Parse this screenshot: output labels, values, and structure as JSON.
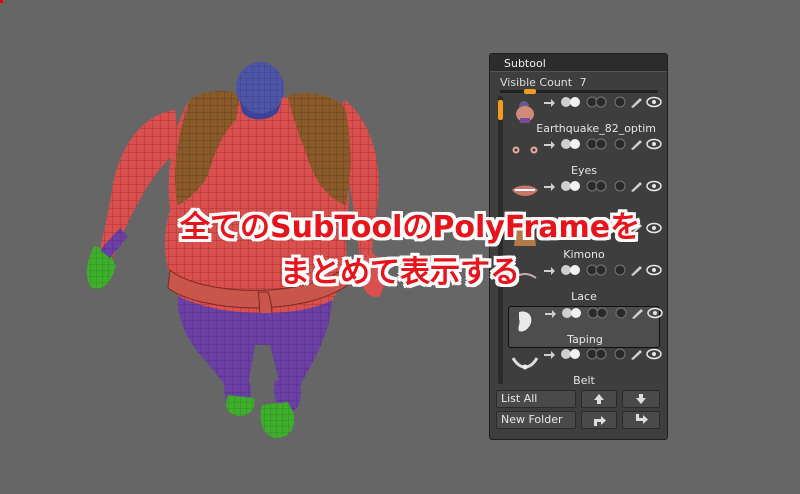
{
  "overlay": {
    "line1": "全てのSubToolのPolyFrameを",
    "line2": "まとめて表示する"
  },
  "panel": {
    "title": "Subtool",
    "visible_count_label": "Visible Count",
    "visible_count_value": "7",
    "items": [
      {
        "label": "Earthquake_82_optim",
        "thumb": "body-thumbnail"
      },
      {
        "label": "Eyes",
        "thumb": "eyes-thumbnail"
      },
      {
        "label": "",
        "thumb": "teeth-thumbnail"
      },
      {
        "label": "Kimono",
        "thumb": "kimono-thumbnail"
      },
      {
        "label": "Lace",
        "thumb": "lace-thumbnail"
      },
      {
        "label": "Taping",
        "thumb": "taping-thumbnail"
      },
      {
        "label": "Belt",
        "thumb": "belt-thumbnail"
      }
    ],
    "buttons": {
      "list_all": "List All",
      "new_folder": "New Folder"
    }
  },
  "colors": {
    "background": "#666666",
    "accent": "#f39c1a",
    "caption_text": "#e8141c",
    "caption_outline": "#ffffff",
    "body_polyframe": "#d9504e",
    "pants": "#6b3fa4",
    "boots": "#3fae2c",
    "vest": "#8a5a2a",
    "head": "#4e55a6"
  },
  "viewport": {
    "model": "sumo wrestler character with PolyFrame wireframe"
  }
}
